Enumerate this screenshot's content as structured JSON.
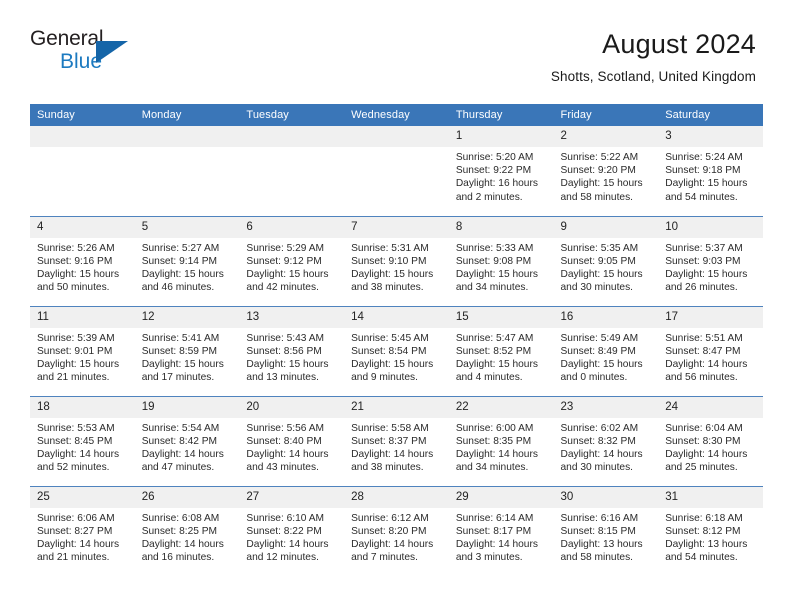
{
  "branding": {
    "name_top": "General",
    "name_bottom": "Blue"
  },
  "header": {
    "title": "August 2024",
    "subtitle": "Shotts, Scotland, United Kingdom"
  },
  "colors": {
    "header_blue": "#3a76b8",
    "row_divider": "#4f83be",
    "daynum_band": "#f0f0f0",
    "logo_blue": "#1c7ac0",
    "logo_triangle": "#1565a8"
  },
  "weekday_headers": [
    "Sunday",
    "Monday",
    "Tuesday",
    "Wednesday",
    "Thursday",
    "Friday",
    "Saturday"
  ],
  "weeks": [
    [
      {
        "day": "",
        "lines": []
      },
      {
        "day": "",
        "lines": []
      },
      {
        "day": "",
        "lines": []
      },
      {
        "day": "",
        "lines": []
      },
      {
        "day": "1",
        "lines": [
          "Sunrise: 5:20 AM",
          "Sunset: 9:22 PM",
          "Daylight: 16 hours",
          "and 2 minutes."
        ]
      },
      {
        "day": "2",
        "lines": [
          "Sunrise: 5:22 AM",
          "Sunset: 9:20 PM",
          "Daylight: 15 hours",
          "and 58 minutes."
        ]
      },
      {
        "day": "3",
        "lines": [
          "Sunrise: 5:24 AM",
          "Sunset: 9:18 PM",
          "Daylight: 15 hours",
          "and 54 minutes."
        ]
      }
    ],
    [
      {
        "day": "4",
        "lines": [
          "Sunrise: 5:26 AM",
          "Sunset: 9:16 PM",
          "Daylight: 15 hours",
          "and 50 minutes."
        ]
      },
      {
        "day": "5",
        "lines": [
          "Sunrise: 5:27 AM",
          "Sunset: 9:14 PM",
          "Daylight: 15 hours",
          "and 46 minutes."
        ]
      },
      {
        "day": "6",
        "lines": [
          "Sunrise: 5:29 AM",
          "Sunset: 9:12 PM",
          "Daylight: 15 hours",
          "and 42 minutes."
        ]
      },
      {
        "day": "7",
        "lines": [
          "Sunrise: 5:31 AM",
          "Sunset: 9:10 PM",
          "Daylight: 15 hours",
          "and 38 minutes."
        ]
      },
      {
        "day": "8",
        "lines": [
          "Sunrise: 5:33 AM",
          "Sunset: 9:08 PM",
          "Daylight: 15 hours",
          "and 34 minutes."
        ]
      },
      {
        "day": "9",
        "lines": [
          "Sunrise: 5:35 AM",
          "Sunset: 9:05 PM",
          "Daylight: 15 hours",
          "and 30 minutes."
        ]
      },
      {
        "day": "10",
        "lines": [
          "Sunrise: 5:37 AM",
          "Sunset: 9:03 PM",
          "Daylight: 15 hours",
          "and 26 minutes."
        ]
      }
    ],
    [
      {
        "day": "11",
        "lines": [
          "Sunrise: 5:39 AM",
          "Sunset: 9:01 PM",
          "Daylight: 15 hours",
          "and 21 minutes."
        ]
      },
      {
        "day": "12",
        "lines": [
          "Sunrise: 5:41 AM",
          "Sunset: 8:59 PM",
          "Daylight: 15 hours",
          "and 17 minutes."
        ]
      },
      {
        "day": "13",
        "lines": [
          "Sunrise: 5:43 AM",
          "Sunset: 8:56 PM",
          "Daylight: 15 hours",
          "and 13 minutes."
        ]
      },
      {
        "day": "14",
        "lines": [
          "Sunrise: 5:45 AM",
          "Sunset: 8:54 PM",
          "Daylight: 15 hours",
          "and 9 minutes."
        ]
      },
      {
        "day": "15",
        "lines": [
          "Sunrise: 5:47 AM",
          "Sunset: 8:52 PM",
          "Daylight: 15 hours",
          "and 4 minutes."
        ]
      },
      {
        "day": "16",
        "lines": [
          "Sunrise: 5:49 AM",
          "Sunset: 8:49 PM",
          "Daylight: 15 hours",
          "and 0 minutes."
        ]
      },
      {
        "day": "17",
        "lines": [
          "Sunrise: 5:51 AM",
          "Sunset: 8:47 PM",
          "Daylight: 14 hours",
          "and 56 minutes."
        ]
      }
    ],
    [
      {
        "day": "18",
        "lines": [
          "Sunrise: 5:53 AM",
          "Sunset: 8:45 PM",
          "Daylight: 14 hours",
          "and 52 minutes."
        ]
      },
      {
        "day": "19",
        "lines": [
          "Sunrise: 5:54 AM",
          "Sunset: 8:42 PM",
          "Daylight: 14 hours",
          "and 47 minutes."
        ]
      },
      {
        "day": "20",
        "lines": [
          "Sunrise: 5:56 AM",
          "Sunset: 8:40 PM",
          "Daylight: 14 hours",
          "and 43 minutes."
        ]
      },
      {
        "day": "21",
        "lines": [
          "Sunrise: 5:58 AM",
          "Sunset: 8:37 PM",
          "Daylight: 14 hours",
          "and 38 minutes."
        ]
      },
      {
        "day": "22",
        "lines": [
          "Sunrise: 6:00 AM",
          "Sunset: 8:35 PM",
          "Daylight: 14 hours",
          "and 34 minutes."
        ]
      },
      {
        "day": "23",
        "lines": [
          "Sunrise: 6:02 AM",
          "Sunset: 8:32 PM",
          "Daylight: 14 hours",
          "and 30 minutes."
        ]
      },
      {
        "day": "24",
        "lines": [
          "Sunrise: 6:04 AM",
          "Sunset: 8:30 PM",
          "Daylight: 14 hours",
          "and 25 minutes."
        ]
      }
    ],
    [
      {
        "day": "25",
        "lines": [
          "Sunrise: 6:06 AM",
          "Sunset: 8:27 PM",
          "Daylight: 14 hours",
          "and 21 minutes."
        ]
      },
      {
        "day": "26",
        "lines": [
          "Sunrise: 6:08 AM",
          "Sunset: 8:25 PM",
          "Daylight: 14 hours",
          "and 16 minutes."
        ]
      },
      {
        "day": "27",
        "lines": [
          "Sunrise: 6:10 AM",
          "Sunset: 8:22 PM",
          "Daylight: 14 hours",
          "and 12 minutes."
        ]
      },
      {
        "day": "28",
        "lines": [
          "Sunrise: 6:12 AM",
          "Sunset: 8:20 PM",
          "Daylight: 14 hours",
          "and 7 minutes."
        ]
      },
      {
        "day": "29",
        "lines": [
          "Sunrise: 6:14 AM",
          "Sunset: 8:17 PM",
          "Daylight: 14 hours",
          "and 3 minutes."
        ]
      },
      {
        "day": "30",
        "lines": [
          "Sunrise: 6:16 AM",
          "Sunset: 8:15 PM",
          "Daylight: 13 hours",
          "and 58 minutes."
        ]
      },
      {
        "day": "31",
        "lines": [
          "Sunrise: 6:18 AM",
          "Sunset: 8:12 PM",
          "Daylight: 13 hours",
          "and 54 minutes."
        ]
      }
    ]
  ]
}
